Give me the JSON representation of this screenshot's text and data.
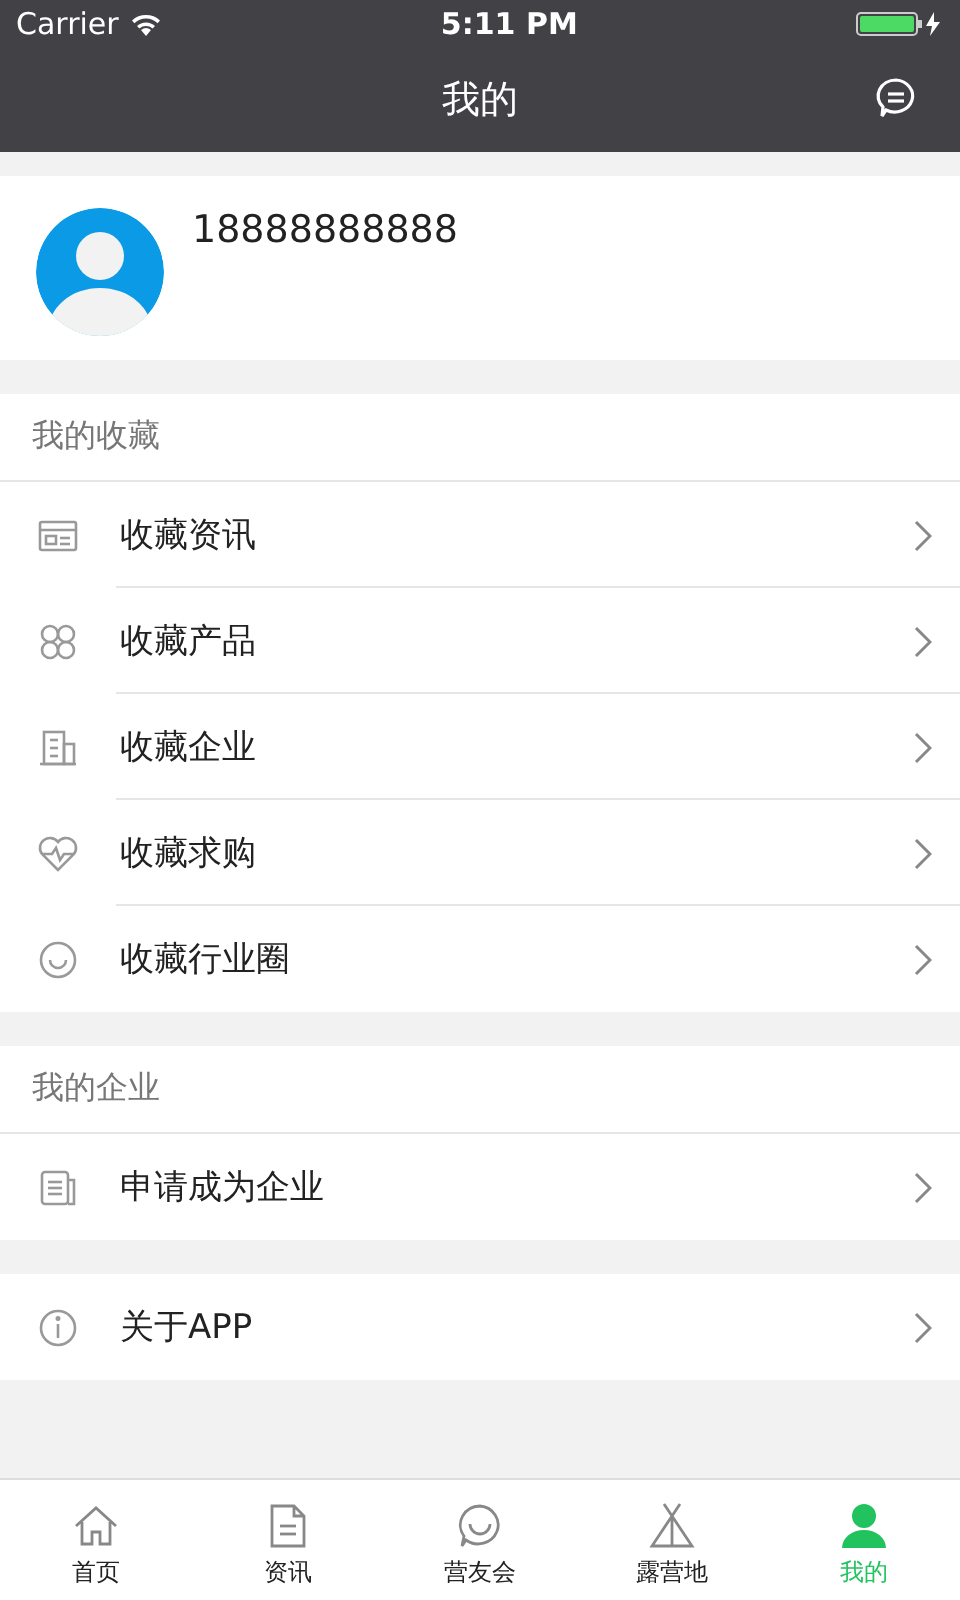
{
  "status_bar": {
    "carrier": "Carrier",
    "time": "5:11 PM"
  },
  "header": {
    "title": "我的"
  },
  "profile": {
    "name": "18888888888"
  },
  "sections": [
    {
      "title": "我的收藏",
      "items": [
        {
          "kind": "news",
          "label": "收藏资讯"
        },
        {
          "kind": "grid",
          "label": "收藏产品"
        },
        {
          "kind": "building",
          "label": "收藏企业"
        },
        {
          "kind": "heart",
          "label": "收藏求购"
        },
        {
          "kind": "smile",
          "label": "收藏行业圈"
        }
      ]
    },
    {
      "title": "我的企业",
      "items": [
        {
          "kind": "doc",
          "label": "申请成为企业"
        }
      ]
    },
    {
      "items": [
        {
          "kind": "info",
          "label": "关于APP"
        }
      ]
    }
  ],
  "tabs": [
    {
      "kind": "home",
      "label": "首页",
      "selected": false
    },
    {
      "kind": "file",
      "label": "资讯",
      "selected": false
    },
    {
      "kind": "chat",
      "label": "营友会",
      "selected": false
    },
    {
      "kind": "tent",
      "label": "露营地",
      "selected": false
    },
    {
      "kind": "person",
      "label": "我的",
      "selected": true
    }
  ]
}
